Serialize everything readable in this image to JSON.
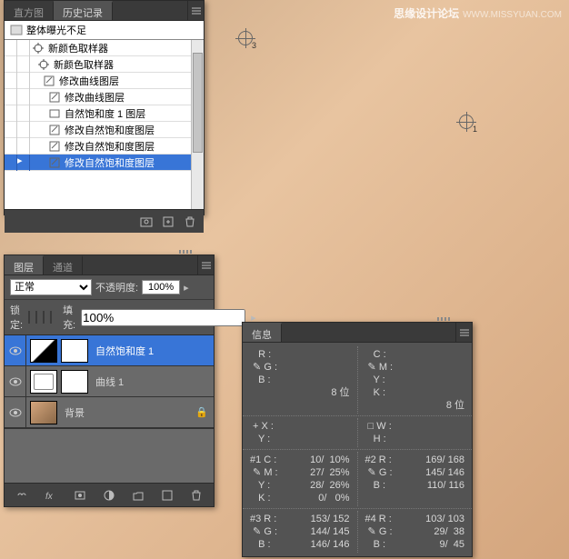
{
  "watermark": {
    "main": "思缘设计论坛",
    "sub": "WWW.MISSYUAN.COM"
  },
  "history": {
    "tabs": [
      "直方图",
      "历史记录"
    ],
    "active_tab": 1,
    "doc_header": "整体曝光不足",
    "items": [
      {
        "label": "新颜色取样器",
        "icon": "sampler"
      },
      {
        "label": "新颜色取样器",
        "icon": "sampler"
      },
      {
        "label": "修改曲线图层",
        "icon": "edit"
      },
      {
        "label": "修改曲线图层",
        "icon": "edit"
      },
      {
        "label": "自然饱和度 1 图层",
        "icon": "layer"
      },
      {
        "label": "修改自然饱和度图层",
        "icon": "edit"
      },
      {
        "label": "修改自然饱和度图层",
        "icon": "edit"
      },
      {
        "label": "修改自然饱和度图层",
        "icon": "edit",
        "selected": true
      }
    ]
  },
  "layers": {
    "tabs": [
      "图层",
      "通道"
    ],
    "active_tab": 0,
    "blend_mode": "正常",
    "opacity_label": "不透明度:",
    "opacity": "100%",
    "lock_label": "锁定:",
    "fill_label": "填充:",
    "fill": "100%",
    "items": [
      {
        "name": "自然饱和度 1",
        "type": "adjustment",
        "selected": true,
        "visible": true
      },
      {
        "name": "曲线 1",
        "type": "curves",
        "visible": true
      },
      {
        "name": "背景",
        "type": "image",
        "visible": true,
        "locked": true
      }
    ]
  },
  "info": {
    "tab": "信息",
    "rgb": {
      "R": "",
      "G": "",
      "B": "",
      "mode": "8 位"
    },
    "cmyk": {
      "C": "",
      "M": "",
      "Y": "",
      "K": "",
      "mode": "8 位"
    },
    "xy": {
      "X": "",
      "Y": ""
    },
    "wh": {
      "W": "",
      "H": ""
    },
    "samplers": [
      {
        "n": "#1",
        "C": "10/  10%",
        "M": "27/  25%",
        "Y": "28/  26%",
        "K": "0/   0%"
      },
      {
        "n": "#2",
        "R": "169/ 168",
        "G": "145/ 146",
        "B": "110/ 116"
      },
      {
        "n": "#3",
        "R": "153/ 152",
        "G": "144/ 145",
        "B": "146/ 146"
      },
      {
        "n": "#4",
        "R": "103/ 103",
        "G": "29/  38",
        "B": "9/  45"
      }
    ]
  }
}
